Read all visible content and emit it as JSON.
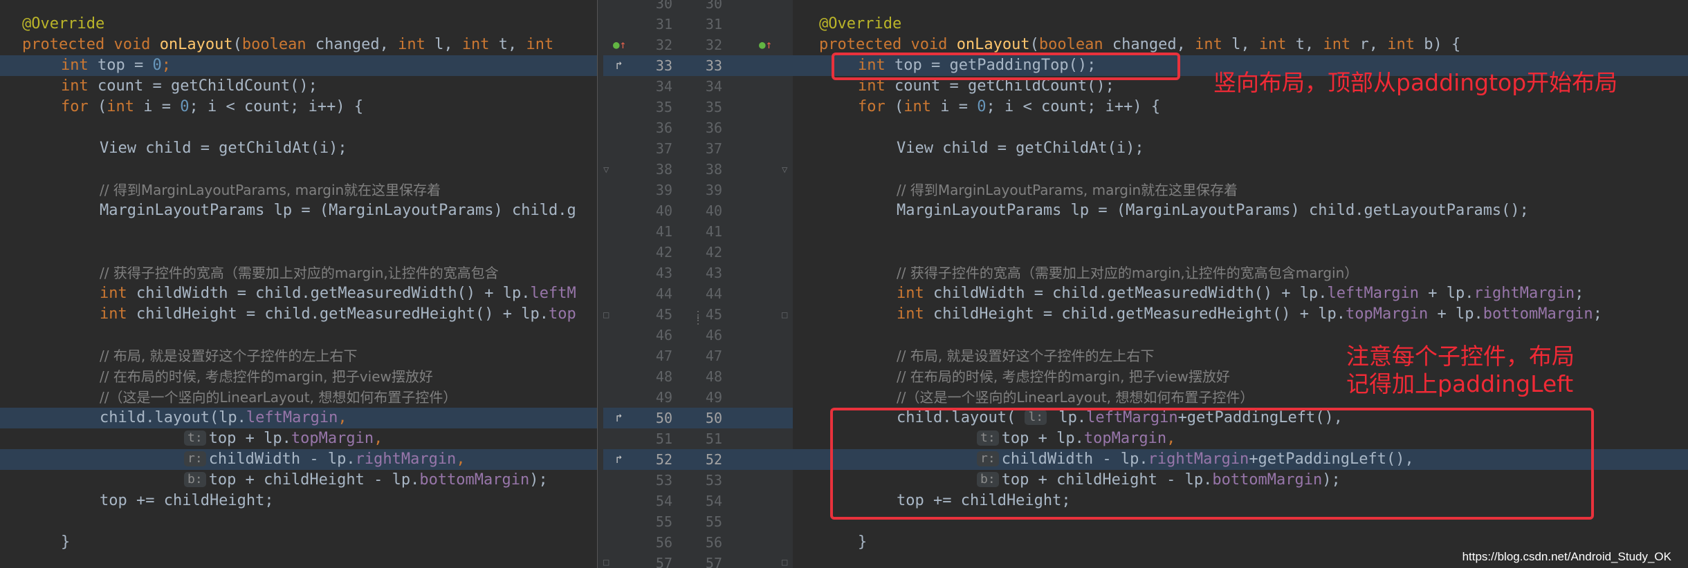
{
  "gutter": {
    "line_numbers": [
      "30",
      "31",
      "32",
      "33",
      "34",
      "35",
      "36",
      "37",
      "38",
      "39",
      "40",
      "41",
      "42",
      "43",
      "44",
      "45",
      "46",
      "47",
      "48",
      "49",
      "50",
      "51",
      "52",
      "53",
      "54",
      "55",
      "56",
      "57"
    ]
  },
  "icons": {
    "override_marker": "override-arrow-icon",
    "diff_marker": "diff-change-icon",
    "fold_marker": "fold-icon"
  },
  "colors": {
    "accent_red": "#e8323c",
    "highlight": "#2e4054"
  },
  "annotations": {
    "top_note": "竖向布局，顶部从paddingtop开始布局",
    "left_note_line1": "注意每个子控件，布局",
    "left_note_line2": "记得加上paddingLeft"
  },
  "watermark": "https://blog.csdn.net/Android_Study_OK",
  "left_code": {
    "l31": "@Override",
    "l32_kw": "protected void ",
    "l32_fn": "onLayout",
    "l32_rest1": "(",
    "l32_kw2": "boolean",
    "l32_rest2": " changed, ",
    "l32_kw3": "int",
    "l32_rest3": " l, ",
    "l32_kw4": "int",
    "l32_rest4": " t, ",
    "l32_kw5": "int",
    "l32_rest5": " ",
    "l33_kw": "int",
    "l33_a": " top = ",
    "l33_num": "0",
    "l33_b": ";",
    "l34_kw": "int",
    "l34_a": " count = getChildCount();",
    "l35_kw": "for",
    "l35_a": " (",
    "l35_kw2": "int",
    "l35_b": " i = ",
    "l35_num": "0",
    "l35_c": "; i < count; i++) {",
    "l37": "View child = getChildAt(i);",
    "l39": "// 得到MarginLayoutParams, margin就在这里保存着",
    "l40": "MarginLayoutParams lp = (MarginLayoutParams) child.g",
    "l43": "// 获得子控件的宽高（需要加上对应的margin,让控件的宽高包含",
    "l44_kw": "int",
    "l44_a": " childWidth = child.getMeasuredWidth() + lp.",
    "l44_f": "leftM",
    "l45_kw": "int",
    "l45_a": " childHeight = child.getMeasuredHeight() + lp.",
    "l45_f": "top",
    "l47": "// 布局, 就是设置好这个子控件的左上右下",
    "l48": "// 在布局的时候, 考虑控件的margin, 把子view摆放好",
    "l49": "//（这是一个竖向的LinearLayout, 想想如何布置子控件）",
    "l50_a": "child.layout(lp.",
    "l50_f": "leftMargin",
    "l50_b": ",",
    "l51_hint": "t:",
    "l51_a": "top + lp.",
    "l51_f": "topMargin",
    "l51_b": ",",
    "l52_hint": "r:",
    "l52_a": "childWidth - lp.",
    "l52_f": "rightMargin",
    "l52_b": ",",
    "l53_hint": "b:",
    "l53_a": "top + childHeight - lp.",
    "l53_f": "bottomMargin",
    "l53_b": ");",
    "l54": "top += childHeight;",
    "l56": "}"
  },
  "right_code": {
    "l31": "@Override",
    "l32_kw": "protected void ",
    "l32_fn": "onLayout",
    "l32_rest1": "(",
    "l32_kw2": "boolean",
    "l32_rest2": " changed, ",
    "l32_kw3": "int",
    "l32_rest3": " l, ",
    "l32_kw4": "int",
    "l32_rest4": " t, ",
    "l32_kw5": "int",
    "l32_rest5": " r, ",
    "l32_kw6": "int",
    "l32_rest6": " b) {",
    "l33_kw": "int",
    "l33_a": " top = getPaddingTop();",
    "l34_kw": "int",
    "l34_a": " count = getChildCount();",
    "l35_kw": "for",
    "l35_a": " (",
    "l35_kw2": "int",
    "l35_b": " i = ",
    "l35_num": "0",
    "l35_c": "; i < count; i++) {",
    "l37": "View child = getChildAt(i);",
    "l39": "// 得到MarginLayoutParams, margin就在这里保存着",
    "l40": "MarginLayoutParams lp = (MarginLayoutParams) child.getLayoutParams();",
    "l43": "// 获得子控件的宽高（需要加上对应的margin,让控件的宽高包含margin）",
    "l44_kw": "int",
    "l44_a": " childWidth = child.getMeasuredWidth() + lp.",
    "l44_f": "leftMargin",
    "l44_b": " + lp.",
    "l44_f2": "rightMargin",
    "l44_c": ";",
    "l45_kw": "int",
    "l45_a": " childHeight = child.getMeasuredHeight() + lp.",
    "l45_f": "topMargin",
    "l45_b": " + lp.",
    "l45_f2": "bottomMargin",
    "l45_c": ";",
    "l47": "// 布局, 就是设置好这个子控件的左上右下",
    "l48": "// 在布局的时候, 考虑控件的margin, 把子view摆放好",
    "l49": "//（这是一个竖向的LinearLayout, 想想如何布置子控件）",
    "l50_a": "child.layout( ",
    "l50_hint": "l:",
    "l50_b": " lp.",
    "l50_f": "leftMargin",
    "l50_c": "+getPaddingLeft(),",
    "l51_hint": "t:",
    "l51_a": "top + lp.",
    "l51_f": "topMargin",
    "l51_b": ",",
    "l52_hint": "r:",
    "l52_a": "childWidth - lp.",
    "l52_f": "rightMargin",
    "l52_b": "+getPaddingLeft(),",
    "l53_hint": "b:",
    "l53_a": "top + childHeight - lp.",
    "l53_f": "bottomMargin",
    "l53_b": ");",
    "l54": "top += childHeight;",
    "l56": "}"
  }
}
